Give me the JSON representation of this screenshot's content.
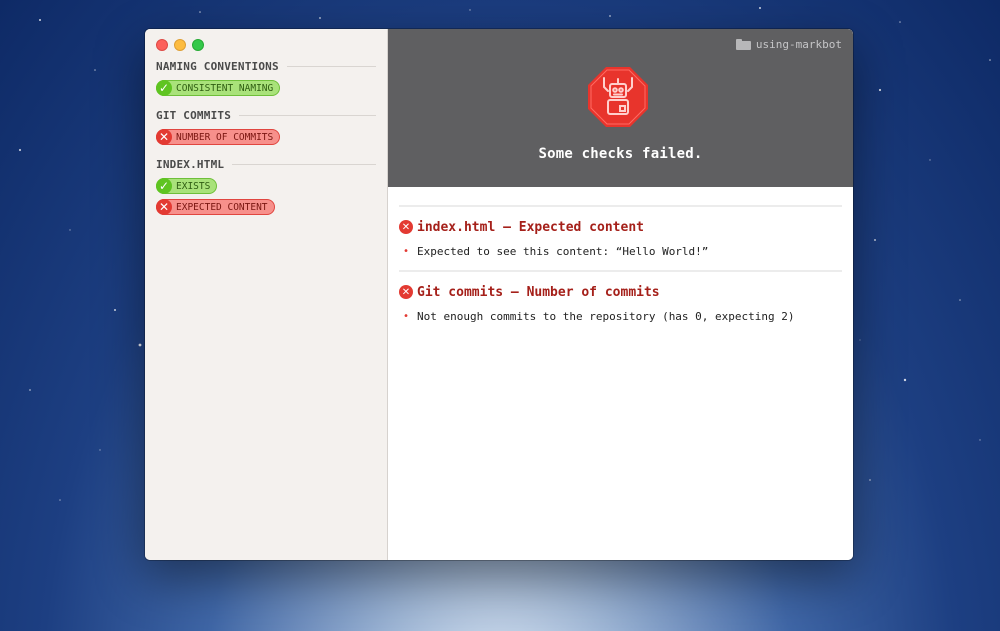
{
  "app": {
    "folder": "using-markbot",
    "status": "Some checks failed."
  },
  "sidebar": {
    "groups": [
      {
        "title": "NAMING CONVENTIONS",
        "checks": [
          {
            "label": "CONSISTENT NAMING",
            "status": "pass"
          }
        ]
      },
      {
        "title": "GIT COMMITS",
        "checks": [
          {
            "label": "NUMBER OF COMMITS",
            "status": "fail"
          }
        ]
      },
      {
        "title": "INDEX.HTML",
        "checks": [
          {
            "label": "EXISTS",
            "status": "pass"
          },
          {
            "label": "EXPECTED CONTENT",
            "status": "fail"
          }
        ]
      }
    ]
  },
  "errors": [
    {
      "title": "index.html — Expected content",
      "items": [
        "Expected to see this content: “Hello World!”"
      ]
    },
    {
      "title": "Git commits — Number of commits",
      "items": [
        "Not enough commits to the repository (has 0, expecting 2)"
      ]
    }
  ],
  "icons": {
    "pass": "check-icon",
    "fail": "x-icon",
    "folder": "folder-icon",
    "robot": "robot-icon"
  },
  "colors": {
    "pass": "#a9e27a",
    "fail": "#f7908b",
    "header": "#5f5f61",
    "error_title": "#a5201a"
  }
}
